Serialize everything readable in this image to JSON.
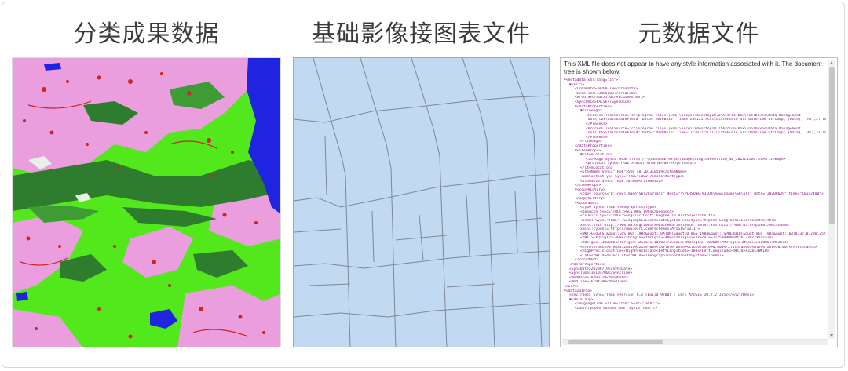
{
  "headings": {
    "classification": "分类成果数据",
    "basemap": "基础影像接图表文件",
    "metadata": "元数据文件"
  },
  "xml_viewer": {
    "banner": "This XML file does not appear to have any style information associated with it. The document tree is shown below.",
    "lines": [
      {
        "indent": 0,
        "text": "▼<metadata xml:lang=\"zh\">"
      },
      {
        "indent": 1,
        "text": "▼<Esri>"
      },
      {
        "indent": 2,
        "text": "<CreaDate>20200719</CreaDate>"
      },
      {
        "indent": 2,
        "text": "<CreaTime>13485800</CreaTime>"
      },
      {
        "indent": 2,
        "text": "<ArcGISFormat>1.0</ArcGISFormat>"
      },
      {
        "indent": 2,
        "text": "<SyncOnce>FALSE</SyncOnce>"
      },
      {
        "indent": 2,
        "text": "▼<DataProperties>"
      },
      {
        "indent": 3,
        "text": "▼<lineage>"
      },
      {
        "indent": 4,
        "text": "<Process ToolSource=\"c:\\program files (x86)\\arcgis\\desktop10.2\\ArcToolbox\\Toolboxes\\Data Management"
      },
      {
        "indent": 4,
        "text": "Tools.tbx\\CalculateField\" Date=\"20200515\" Time=\"204121\">CalculateField all DateTime StrComp( [Date], [Al],2) VB"
      },
      {
        "indent": 4,
        "text": "</Process>"
      },
      {
        "indent": 4,
        "text": "<Process ToolSource=\"c:\\program files (x86)\\arcgis\\desktop10.2\\ArcToolbox\\Toolboxes\\Data Management"
      },
      {
        "indent": 4,
        "text": "Tools.tbx\\CalculateField\" Date=\"20200515\" Time=\"212932\">CalculateField all DateTime StrComp( [Date], [Al],2) VB"
      },
      {
        "indent": 4,
        "text": "</Process>"
      },
      {
        "indent": 3,
        "text": "</lineage>"
      },
      {
        "indent": 2,
        "text": "</DataProperties>"
      },
      {
        "indent": 2,
        "text": "▼<itemProps>"
      },
      {
        "indent": 3,
        "text": "▼<itemLocation>"
      },
      {
        "indent": 4,
        "text": "<linkage Sync=\"TRUE\">file://\\\\PERSONE-93\\D$\\image\\SingleSheet\\S26_40_2013L0509.shp</linkage>"
      },
      {
        "indent": 4,
        "text": "<protocol Sync=\"TRUE\">Local Area Network</protocol>"
      },
      {
        "indent": 3,
        "text": "</itemLocation>"
      },
      {
        "indent": 3,
        "text": "<itemName Sync=\"TRUE\">S26_40_2013L0509</itemName>"
      },
      {
        "indent": 3,
        "text": "<imsContentType Sync=\"TRUE\">002</imsContentType>"
      },
      {
        "indent": 3,
        "text": "<itemSize Sync=\"TRUE\">0.000</itemSize>"
      },
      {
        "indent": 2,
        "text": "</itemProps>"
      },
      {
        "indent": 2,
        "text": "▼<copyHistory>"
      },
      {
        "indent": 3,
        "text": "<copy source=\"D:\\new\\image\\S6\\2017\\all\" dest=\"\\\\PERSONE-93\\D$\\new\\image\\S6\\all\" date=\"20200629\" time=\"10142400\">"
      },
      {
        "indent": 2,
        "text": "</copyHistory>"
      },
      {
        "indent": 2,
        "text": "▼<coordRef>"
      },
      {
        "indent": 3,
        "text": "<type Sync=\"TRUE\">Geographic</type>"
      },
      {
        "indent": 3,
        "text": "<geogcsn Sync=\"TRUE\">GCS_WGS_1984</geogcsn>"
      },
      {
        "indent": 3,
        "text": "<csUnits Sync=\"TRUE\">Angular Unit: Degree (0.017453)</csUnits>"
      },
      {
        "indent": 3,
        "text": "<peXml Sync=\"TRUE\"><GeographicCoordinateSystem xsi:type='typens:GeographicCoordinateSystem'"
      },
      {
        "indent": 3,
        "text": "xmlns:xsi='http://www.w3.org/2001/XMLSchema-instance' xmlns:xs='http://www.w3.org/2001/XMLSchema'"
      },
      {
        "indent": 3,
        "text": "xmlns:typens='http://www.esri.com/schemas/ArcGIS/10.1'>"
      },
      {
        "indent": 3,
        "text": "<WKT>GEOGCS[&quot;GCS_WGS_1984&quot;,DATUM[&quot;D_WGS_1984&quot;,SPHEROID[&quot;WGS_1984&quot;,6378137.0,298.2572"
      },
      {
        "indent": 3,
        "text": "</WKT><XOrigin>-400</XOrigin><YOrigin>-400</YOrigin><XYScale>11258999068426.238</XYScale>"
      },
      {
        "indent": 3,
        "text": "<ZOrigin>-100000</ZOrigin><ZScale>10000</ZScale><MOrigin>-100000</MOrigin><MScale>10000</MScale>"
      },
      {
        "indent": 3,
        "text": "<XYTolerance>8.983152841195214e-009</XYTolerance><ZTolerance>0.001</ZTolerance><MTolerance>0.001</MTolerance>"
      },
      {
        "indent": 3,
        "text": "<HighPrecision>true</HighPrecision><LeftLongitude>-180</LeftLongitude><WKID>4326</WKID>"
      },
      {
        "indent": 3,
        "text": "<LatestWKID>4326</LatestWKID></GeographicCoordinateSystem></peXml>"
      },
      {
        "indent": 2,
        "text": "</coordRef>"
      },
      {
        "indent": 1,
        "text": "</DataProperties>"
      },
      {
        "indent": 1,
        "text": "<SyncDate>20200719</SyncDate>"
      },
      {
        "indent": 1,
        "text": "<SyncTime>16194700</SyncTime>"
      },
      {
        "indent": 1,
        "text": "<ModDate>20200719</ModDate>"
      },
      {
        "indent": 1,
        "text": "<ModTime>16194700</ModTime>"
      },
      {
        "indent": 0,
        "text": "</Esri>"
      },
      {
        "indent": 0,
        "text": "▼<dataIdInfo>"
      },
      {
        "indent": 1,
        "text": "<envirDesc Sync=\"TRUE\">Version 6.2 (Build 9200) ; Esri ArcGIS 10.2.2.3552</envirDesc>"
      },
      {
        "indent": 1,
        "text": "▼<dataLang>"
      },
      {
        "indent": 2,
        "text": "<languageCode value=\"zho\" Sync=\"TRUE\"/>"
      },
      {
        "indent": 2,
        "text": "<countryCode value=\"CHN\" Sync=\"TRUE\"/>"
      }
    ]
  },
  "colors": {
    "pink": "#ea9ede",
    "bright_green": "#52e81c",
    "dark_green": "#2e7d2e",
    "water_blue": "#1f24e0",
    "urban_red": "#cc2424",
    "basemap_fill": "#c2d9f2",
    "basemap_line": "#7f8894"
  }
}
